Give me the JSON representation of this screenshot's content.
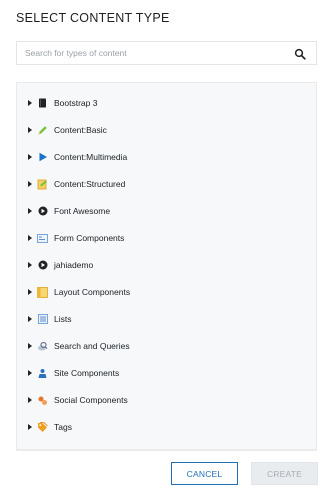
{
  "dialog": {
    "title": "SELECT CONTENT TYPE"
  },
  "search": {
    "placeholder": "Search for types of content",
    "value": "",
    "icon": "search-icon"
  },
  "tree": {
    "items": [
      {
        "label": "Bootstrap 3",
        "icon": "book-icon",
        "color": "#222222"
      },
      {
        "label": "Content:Basic",
        "icon": "pencil-icon",
        "color": "#7cc242"
      },
      {
        "label": "Content:Multimedia",
        "icon": "play-icon",
        "color": "#1a73c7"
      },
      {
        "label": "Content:Structured",
        "icon": "structured-doc-icon",
        "color": "#f3b12a"
      },
      {
        "label": "Font Awesome",
        "icon": "font-awesome-icon",
        "color": "#222222"
      },
      {
        "label": "Form Components",
        "icon": "form-icon",
        "color": "#5b8fd0"
      },
      {
        "label": "jahiademo",
        "icon": "jahia-icon",
        "color": "#222222"
      },
      {
        "label": "Layout Components",
        "icon": "layout-icon",
        "color": "#f3b12a"
      },
      {
        "label": "Lists",
        "icon": "list-icon",
        "color": "#5b8fd0"
      },
      {
        "label": "Search and Queries",
        "icon": "search-query-icon",
        "color": "#6b7a8f"
      },
      {
        "label": "Site Components",
        "icon": "site-components-icon",
        "color": "#2c6fbd"
      },
      {
        "label": "Social Components",
        "icon": "social-icon",
        "color": "#e8762c"
      },
      {
        "label": "Tags",
        "icon": "tags-icon",
        "color": "#f0a020"
      }
    ]
  },
  "buttons": {
    "cancel": "CANCEL",
    "create": "CREATE"
  },
  "colors": {
    "accent": "#1f6fb5",
    "panel_bg": "#f6f8fa",
    "disabled_bg": "#e9ecef",
    "disabled_text": "#a7adb3"
  }
}
